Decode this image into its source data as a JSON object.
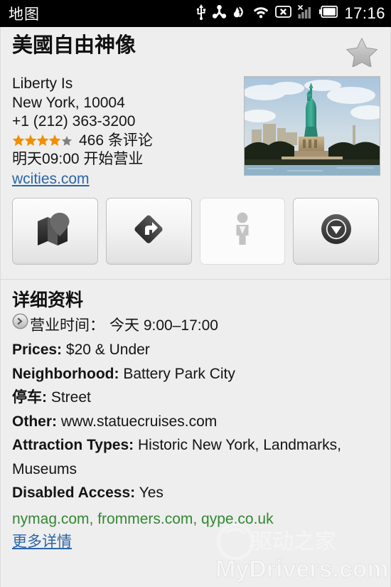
{
  "statusbar": {
    "app_title": "地图",
    "clock": "17:16",
    "icons": [
      {
        "name": "usb-icon",
        "label": "USB"
      },
      {
        "name": "android-sync-icon",
        "label": "Sync"
      },
      {
        "name": "vibrate-icon",
        "label": "Vibrate"
      },
      {
        "name": "wifi-icon",
        "label": "Wi-Fi"
      },
      {
        "name": "sdcard-removed-icon",
        "label": "SD card removed"
      },
      {
        "name": "signal-bars-no-service-icon",
        "label": "Signal"
      },
      {
        "name": "battery-icon",
        "label": "Battery"
      }
    ]
  },
  "place": {
    "title": "美國自由神像",
    "favorite_star": "unfilled",
    "address_line1": "Liberty Is",
    "address_line2": "New York, 10004",
    "phone": "+1 (212) 363-3200",
    "rating_filled_stars": 4,
    "rating_total_stars": 5,
    "review_count_text": "466 条评论",
    "open_status": "明天09:00 开始营业",
    "website": "wcities.com",
    "photo_alt": "Statue of Liberty"
  },
  "actions": [
    {
      "name": "show-on-map-button",
      "icon": "map-pin-icon",
      "enabled": true
    },
    {
      "name": "directions-button",
      "icon": "directions-arrow-icon",
      "enabled": true
    },
    {
      "name": "street-view-button",
      "icon": "pegman-icon",
      "enabled": false
    },
    {
      "name": "more-options-button",
      "icon": "circle-down-arrow-icon",
      "enabled": true
    }
  ],
  "details": {
    "heading": "详细资料",
    "hours_label": "营业时间：",
    "hours_value": "今天 9:00–17:00",
    "rows": [
      {
        "label": "Prices:",
        "value": "$20 & Under",
        "label_bold": true
      },
      {
        "label": "Neighborhood:",
        "value": "Battery Park City",
        "label_bold": true
      },
      {
        "label": "停车:",
        "value": "Street",
        "label_bold": true
      },
      {
        "label": "Other:",
        "value": "www.statuecruises.com",
        "label_bold": true
      },
      {
        "label": "Attraction Types:",
        "value": "Historic New York, Landmarks, Museums",
        "label_bold": true
      },
      {
        "label": "Disabled Access:",
        "value": "Yes",
        "label_bold": true
      }
    ],
    "source_links": "nymag.com, frommers.com, qype.co.uk",
    "more_details_link": "更多详情"
  },
  "watermark": {
    "chinese": "驱动之家",
    "latin": "MyDrivers.com"
  },
  "colors": {
    "background": "#eeeeee",
    "statusbar": "#000000",
    "link_blue": "#2a65a8",
    "link_green": "#338833",
    "star_orange": "#f09000",
    "star_gray": "#808080",
    "text": "#141414"
  }
}
